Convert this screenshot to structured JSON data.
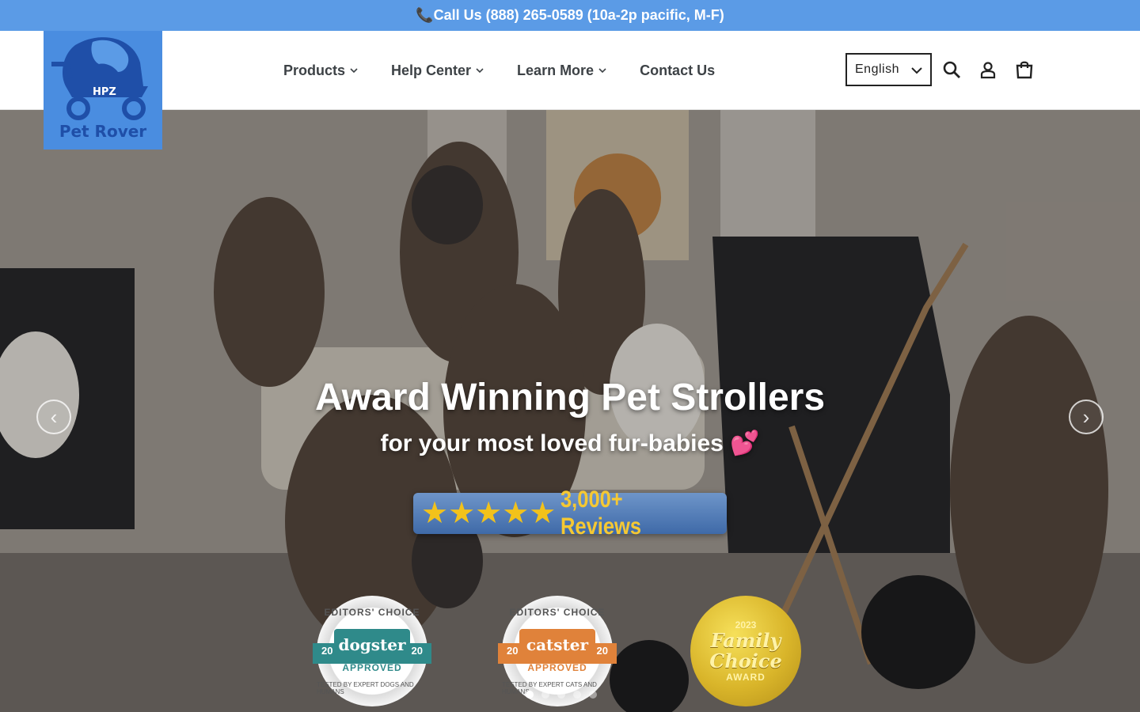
{
  "announcement": {
    "icon": "phone-icon",
    "text": "📞Call Us (888) 265-0589 (10a-2p pacific, M-F)"
  },
  "brand": {
    "name": "Pet Rover",
    "mark": "HPZ",
    "color": "#4a8de0"
  },
  "nav": {
    "items": [
      {
        "label": "Products",
        "has_dropdown": true
      },
      {
        "label": "Help Center",
        "has_dropdown": true
      },
      {
        "label": "Learn More",
        "has_dropdown": true
      },
      {
        "label": "Contact Us",
        "has_dropdown": false
      }
    ]
  },
  "header": {
    "language": "English",
    "icons": [
      "search-icon",
      "account-icon",
      "cart-icon"
    ]
  },
  "hero": {
    "title": "Award Winning Pet Strollers",
    "subtitle": "for your most loved fur-babies 💕",
    "reviews": {
      "stars": "★★★★★",
      "rating": 5,
      "text": "3,000+ Reviews"
    },
    "badges": [
      {
        "top": "EDITORS' CHOICE",
        "name": "dogster",
        "status": "APPROVED",
        "year_left": "20",
        "year_right": "20",
        "bottom": "TESTED BY EXPERT DOGS AND HUMANS",
        "color": "#2f8a8a"
      },
      {
        "top": "EDITORS' CHOICE",
        "name": "catster",
        "status": "APPROVED",
        "year_left": "20",
        "year_right": "20",
        "bottom": "TESTED BY EXPERT CATS AND HUMANS",
        "color": "#e0823a"
      },
      {
        "year": "2023",
        "name": "Family Choice",
        "status": "AWARD",
        "color": "#d9b52a"
      }
    ],
    "slides": {
      "count": 5,
      "active": 1
    }
  }
}
